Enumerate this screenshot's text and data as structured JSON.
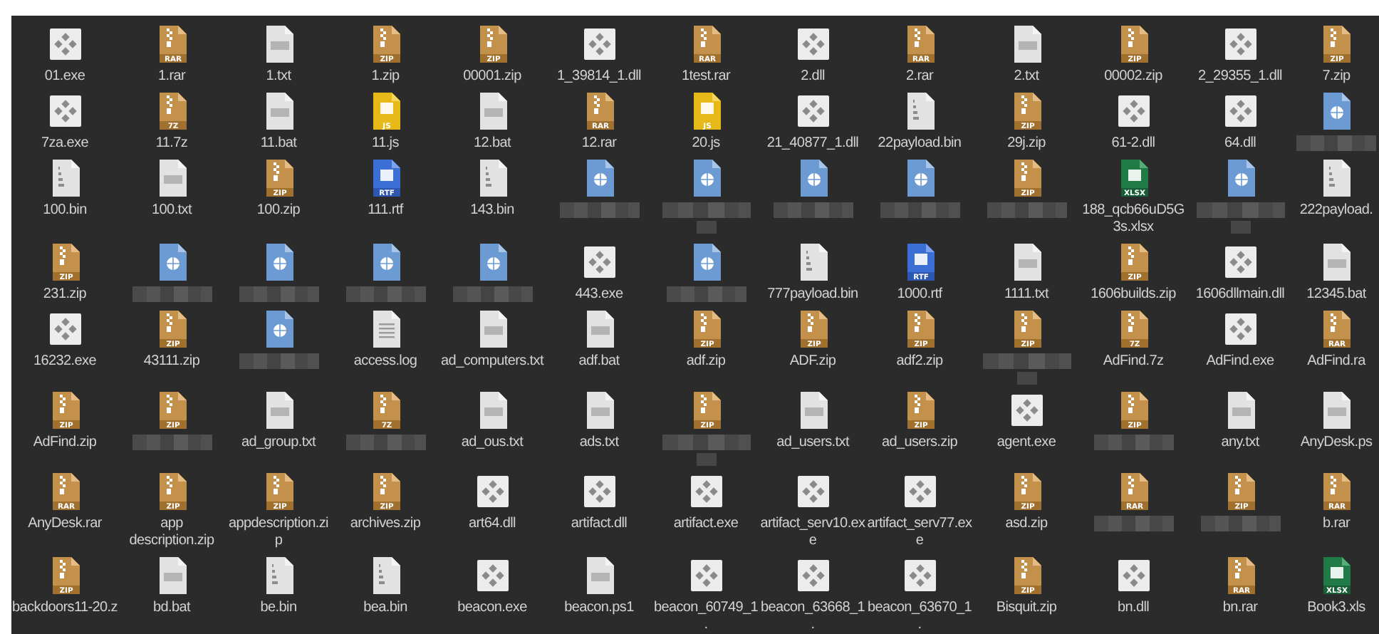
{
  "files": [
    {
      "kind": "exe",
      "name": "01.exe"
    },
    {
      "kind": "archive",
      "badge": "RAR",
      "name": "1.rar"
    },
    {
      "kind": "text",
      "name": "1.txt"
    },
    {
      "kind": "archive",
      "badge": "ZIP",
      "name": "1.zip"
    },
    {
      "kind": "archive",
      "badge": "ZIP",
      "name": "00001.zip"
    },
    {
      "kind": "exe",
      "name": "1_39814_1.dll"
    },
    {
      "kind": "archive",
      "badge": "RAR",
      "name": "1test.rar"
    },
    {
      "kind": "exe",
      "name": "2.dll"
    },
    {
      "kind": "archive",
      "badge": "RAR",
      "name": "2.rar"
    },
    {
      "kind": "text",
      "name": "2.txt"
    },
    {
      "kind": "archive",
      "badge": "ZIP",
      "name": "00002.zip"
    },
    {
      "kind": "exe",
      "name": "2_29355_1.dll"
    },
    {
      "kind": "archive",
      "badge": "ZIP",
      "name": "7.zip"
    },
    {
      "kind": "exe",
      "name": "7za.exe"
    },
    {
      "kind": "archive",
      "badge": "7Z",
      "name": "11.7z"
    },
    {
      "kind": "text",
      "name": "11.bat"
    },
    {
      "kind": "badgedoc",
      "badge": "JS",
      "name": "11.js"
    },
    {
      "kind": "text",
      "name": "12.bat"
    },
    {
      "kind": "archive",
      "badge": "RAR",
      "name": "12.rar"
    },
    {
      "kind": "badgedoc",
      "badge": "JS",
      "name": "20.js"
    },
    {
      "kind": "exe",
      "name": "21_40877_1.dll"
    },
    {
      "kind": "binary",
      "name": "22payload.bin"
    },
    {
      "kind": "archive",
      "badge": "ZIP",
      "name": "29j.zip"
    },
    {
      "kind": "exe",
      "name": "61-2.dll"
    },
    {
      "kind": "exe",
      "name": "64.dll"
    },
    {
      "kind": "web",
      "redacted": true
    },
    {
      "kind": "binary",
      "name": "100.bin"
    },
    {
      "kind": "text",
      "name": "100.txt"
    },
    {
      "kind": "archive",
      "badge": "ZIP",
      "name": "100.zip"
    },
    {
      "kind": "badgedoc",
      "badge": "RTF",
      "name": "111.rtf"
    },
    {
      "kind": "binary",
      "name": "143.bin"
    },
    {
      "kind": "web",
      "redacted": true
    },
    {
      "kind": "web",
      "redacted": true,
      "wrapped": true
    },
    {
      "kind": "web",
      "redacted": true
    },
    {
      "kind": "web",
      "redacted": true
    },
    {
      "kind": "archive",
      "badge": "ZIP",
      "redacted": true
    },
    {
      "kind": "badgedoc",
      "badge": "XLSX",
      "name": "188_qcb66uD5G3s.xlsx"
    },
    {
      "kind": "web",
      "redacted": true,
      "wrapped": true
    },
    {
      "kind": "binary",
      "name": "222payload."
    },
    {
      "kind": "archive",
      "badge": "ZIP",
      "name": "231.zip"
    },
    {
      "kind": "web",
      "redacted": true
    },
    {
      "kind": "web",
      "redacted": true
    },
    {
      "kind": "web",
      "redacted": true
    },
    {
      "kind": "web",
      "redacted": true
    },
    {
      "kind": "exe",
      "name": "443.exe"
    },
    {
      "kind": "web",
      "redacted": true
    },
    {
      "kind": "binary",
      "name": "777payload.bin"
    },
    {
      "kind": "badgedoc",
      "badge": "RTF",
      "name": "1000.rtf"
    },
    {
      "kind": "text",
      "name": "1111.txt"
    },
    {
      "kind": "archive",
      "badge": "ZIP",
      "name": "1606builds.zip"
    },
    {
      "kind": "exe",
      "name": "1606dllmain.dll"
    },
    {
      "kind": "text",
      "name": "12345.bat"
    },
    {
      "kind": "exe",
      "name": "16232.exe"
    },
    {
      "kind": "archive",
      "badge": "ZIP",
      "name": "43111.zip"
    },
    {
      "kind": "web",
      "redacted": true
    },
    {
      "kind": "log",
      "name": "access.log"
    },
    {
      "kind": "text",
      "name": "ad_computers.txt"
    },
    {
      "kind": "text",
      "name": "adf.bat"
    },
    {
      "kind": "archive",
      "badge": "ZIP",
      "name": "adf.zip"
    },
    {
      "kind": "archive",
      "badge": "ZIP",
      "name": "ADF.zip"
    },
    {
      "kind": "archive",
      "badge": "ZIP",
      "name": "adf2.zip"
    },
    {
      "kind": "archive",
      "badge": "ZIP",
      "redacted": true,
      "wrapped": true
    },
    {
      "kind": "archive",
      "badge": "7Z",
      "name": "AdFind.7z"
    },
    {
      "kind": "exe",
      "name": "AdFind.exe"
    },
    {
      "kind": "archive",
      "badge": "RAR",
      "name": "AdFind.ra"
    },
    {
      "kind": "archive",
      "badge": "ZIP",
      "name": "AdFind.zip"
    },
    {
      "kind": "archive",
      "badge": "ZIP",
      "redacted": true
    },
    {
      "kind": "text",
      "name": "ad_group.txt"
    },
    {
      "kind": "archive",
      "badge": "7Z",
      "redacted": true
    },
    {
      "kind": "text",
      "name": "ad_ous.txt"
    },
    {
      "kind": "text",
      "name": "ads.txt"
    },
    {
      "kind": "archive",
      "badge": "ZIP",
      "redacted": true,
      "wrapped": true
    },
    {
      "kind": "text",
      "name": "ad_users.txt"
    },
    {
      "kind": "archive",
      "badge": "ZIP",
      "name": "ad_users.zip"
    },
    {
      "kind": "exe",
      "name": "agent.exe"
    },
    {
      "kind": "archive",
      "badge": "ZIP",
      "redacted": true
    },
    {
      "kind": "text",
      "name": "any.txt"
    },
    {
      "kind": "text",
      "name": "AnyDesk.ps"
    },
    {
      "kind": "archive",
      "badge": "RAR",
      "name": "AnyDesk.rar"
    },
    {
      "kind": "archive",
      "badge": "ZIP",
      "name": "app description.zip"
    },
    {
      "kind": "archive",
      "badge": "ZIP",
      "name": "appdescription.zip"
    },
    {
      "kind": "archive",
      "badge": "ZIP",
      "name": "archives.zip"
    },
    {
      "kind": "exe",
      "name": "art64.dll"
    },
    {
      "kind": "exe",
      "name": "artifact.dll"
    },
    {
      "kind": "exe",
      "name": "artifact.exe"
    },
    {
      "kind": "exe",
      "name": "artifact_serv10.exe"
    },
    {
      "kind": "exe",
      "name": "artifact_serv77.exe"
    },
    {
      "kind": "archive",
      "badge": "ZIP",
      "name": "asd.zip"
    },
    {
      "kind": "archive",
      "badge": "RAR",
      "redacted": true
    },
    {
      "kind": "archive",
      "badge": "ZIP",
      "redacted": true
    },
    {
      "kind": "archive",
      "badge": "RAR",
      "name": "b.rar"
    },
    {
      "kind": "archive",
      "badge": "ZIP",
      "name": "backdoors11-20.z"
    },
    {
      "kind": "text",
      "name": "bd.bat"
    },
    {
      "kind": "binary",
      "name": "be.bin"
    },
    {
      "kind": "binary",
      "name": "bea.bin"
    },
    {
      "kind": "exe",
      "name": "beacon.exe"
    },
    {
      "kind": "text",
      "name": "beacon.ps1"
    },
    {
      "kind": "exe",
      "name": "beacon_60749_1."
    },
    {
      "kind": "exe",
      "name": "beacon_63668_1."
    },
    {
      "kind": "exe",
      "name": "beacon_63670_1."
    },
    {
      "kind": "archive",
      "badge": "ZIP",
      "name": "Bisquit.zip"
    },
    {
      "kind": "exe",
      "name": "bn.dll"
    },
    {
      "kind": "archive",
      "badge": "RAR",
      "name": "bn.rar"
    },
    {
      "kind": "badgedoc",
      "badge": "XLSX",
      "name": "Book3.xls"
    }
  ]
}
